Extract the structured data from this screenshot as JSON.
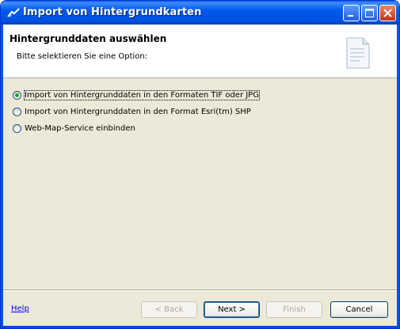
{
  "window": {
    "title": "Import von Hintergrundkarten",
    "colors": {
      "titlebar": "#0058ee",
      "close": "#c2351a",
      "face": "#ece9d8"
    }
  },
  "titlebar_icons": [
    "app-icon",
    "minimize-icon",
    "maximize-icon",
    "close-icon"
  ],
  "header": {
    "title": "Hintergrunddaten auswählen",
    "subtitle": "Bitte selektieren Sie eine Option:",
    "icon": "document-icon"
  },
  "options": [
    {
      "label": "Import von Hintergrunddaten in den Formaten TIF oder JPG",
      "checked": true
    },
    {
      "label": "Import von Hintergrunddaten in den Format Esri(tm) SHP",
      "checked": false
    },
    {
      "label": "Web-Map-Service einbinden",
      "checked": false
    }
  ],
  "footer": {
    "help": "Help",
    "back": "< Back",
    "next": "Next >",
    "finish": "Finish",
    "cancel": "Cancel"
  }
}
